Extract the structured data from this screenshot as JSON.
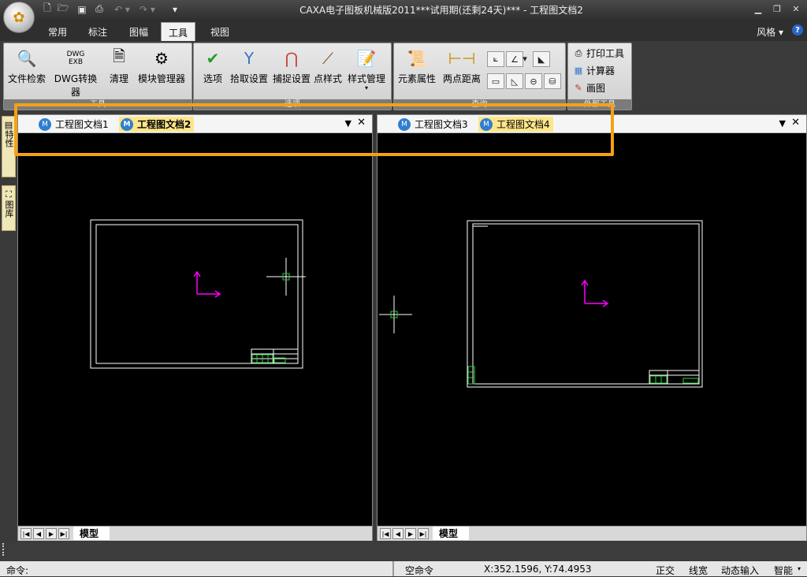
{
  "window": {
    "title": "CAXA电子图板机械版2011***试用期(还剩24天)*** - 工程图文档2"
  },
  "menu_tabs": [
    "常用",
    "标注",
    "图幅",
    "工具",
    "视图"
  ],
  "active_menu_tab": "工具",
  "style_menu": "风格",
  "help_symbol": "?",
  "ribbon": {
    "groups": [
      {
        "label": "工具",
        "buttons": [
          "文件检索",
          "DWG转换器",
          "清理",
          "模块管理器"
        ]
      },
      {
        "label": "选项",
        "buttons": [
          "选项",
          "拾取设置",
          "捕捉设置",
          "点样式",
          "样式管理"
        ]
      },
      {
        "label": "查询",
        "buttons": [
          "元素属性",
          "两点距离"
        ]
      },
      {
        "label": "外部工具",
        "buttons": [
          "打印工具",
          "计算器",
          "画图"
        ]
      }
    ]
  },
  "side_tabs": [
    "特性",
    "图库"
  ],
  "panes": [
    {
      "tabs": [
        "工程图文档1",
        "工程图文档2"
      ],
      "active": "工程图文档2",
      "model_tab": "模型"
    },
    {
      "tabs": [
        "工程图文档3",
        "工程图文档4"
      ],
      "active": "工程图文档4",
      "model_tab": "模型"
    }
  ],
  "command": {
    "prompt": "命令:",
    "state": "空命令"
  },
  "coordinates": "X:352.1596, Y:74.4953",
  "status_toggles": [
    "正交",
    "线宽",
    "动态输入",
    "智能"
  ],
  "colors": {
    "highlight": "#f5a115",
    "ucs_axis": "#ff00ff",
    "crosshair_box": "#00cc44"
  }
}
